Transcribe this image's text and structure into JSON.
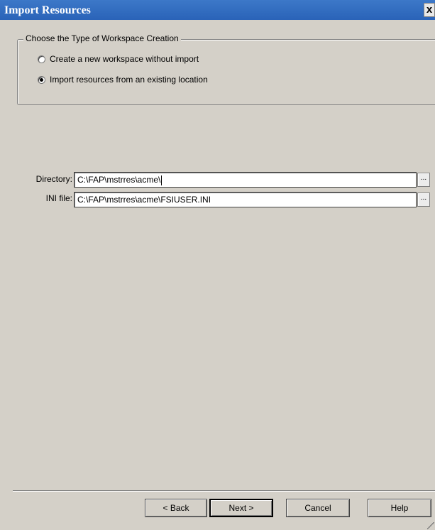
{
  "window": {
    "title": "Import Resources",
    "close_label": "x"
  },
  "group": {
    "legend": "Choose the Type of Workspace Creation",
    "options": [
      {
        "label": "Create a new workspace without import",
        "selected": false
      },
      {
        "label": "Import resources from an existing location",
        "selected": true
      }
    ]
  },
  "fields": {
    "directory": {
      "label": "Directory:",
      "value": "C:\\FAP\\mstrres\\acme\\",
      "browse_label": "..."
    },
    "ini_file": {
      "label": "INI file:",
      "value": "C:\\FAP\\mstrres\\acme\\FSIUSER.INI",
      "browse_label": "..."
    }
  },
  "buttons": {
    "back": "< Back",
    "next": "Next >",
    "cancel": "Cancel",
    "help": "Help"
  },
  "colors": {
    "titlebar": "#2a63b8",
    "dialog_bg": "#d4d0c8"
  }
}
